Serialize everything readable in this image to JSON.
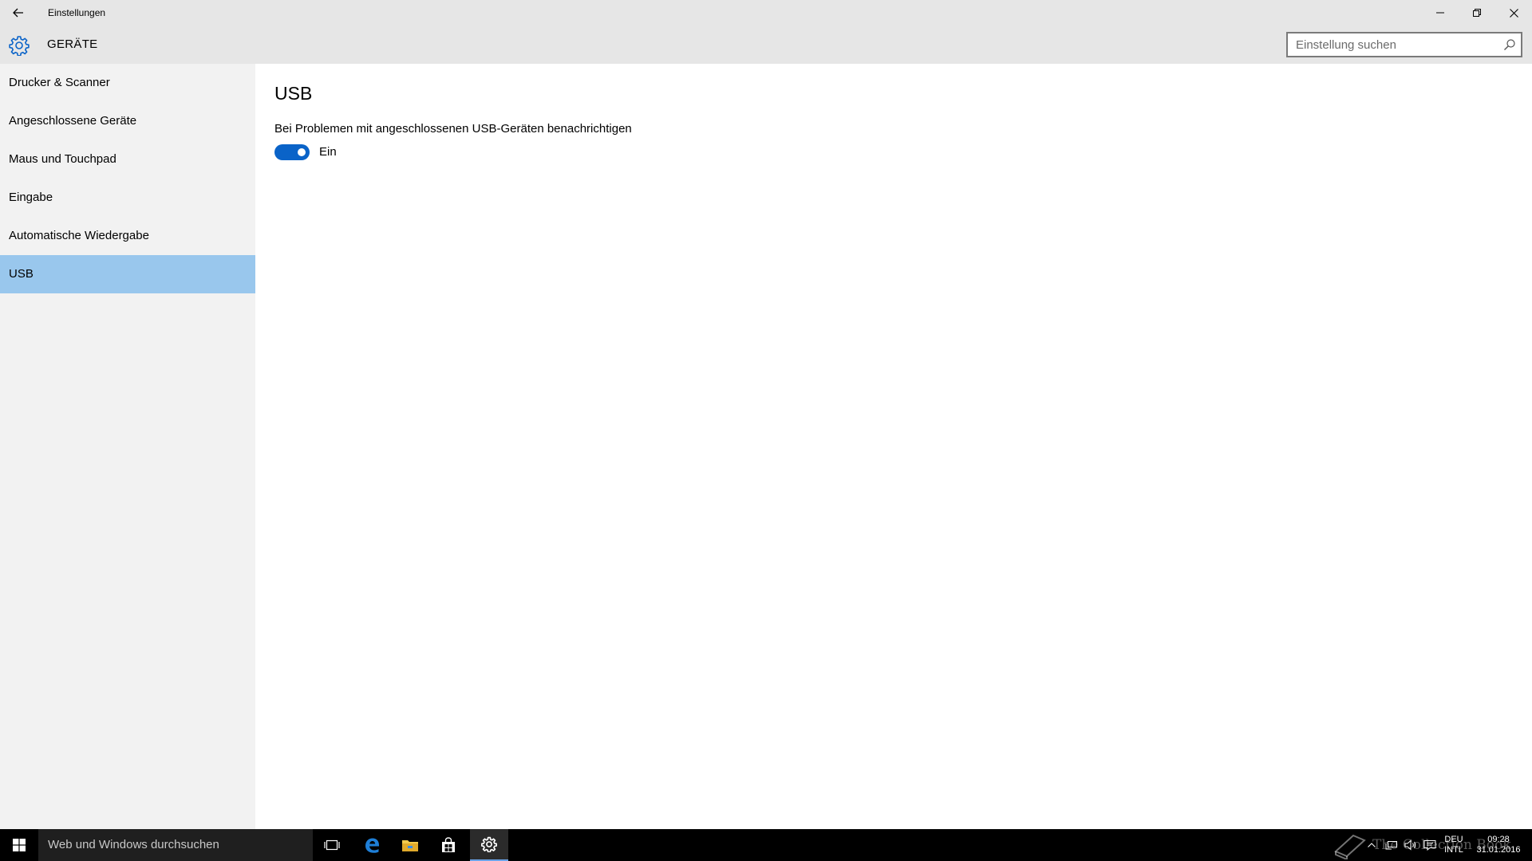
{
  "window": {
    "title": "Einstellungen"
  },
  "header": {
    "section_title": "GERÄTE",
    "search_placeholder": "Einstellung suchen"
  },
  "sidebar": {
    "items": [
      {
        "label": "Drucker & Scanner",
        "active": false
      },
      {
        "label": "Angeschlossene Geräte",
        "active": false
      },
      {
        "label": "Maus und Touchpad",
        "active": false
      },
      {
        "label": "Eingabe",
        "active": false
      },
      {
        "label": "Automatische Wiedergabe",
        "active": false
      },
      {
        "label": "USB",
        "active": true
      }
    ]
  },
  "content": {
    "page_title": "USB",
    "setting_label": "Bei Problemen mit angeschlossenen USB-Geräten benachrichtigen",
    "toggle_on": true,
    "toggle_state_label": "Ein"
  },
  "taskbar": {
    "search_placeholder": "Web und Windows durchsuchen",
    "pinned": [
      "task-view-icon",
      "edge-icon",
      "file-explorer-icon",
      "store-icon",
      "settings-icon"
    ],
    "active_app": "settings-icon",
    "language_top": "DEU",
    "language_bottom": "INTL",
    "time": "09:28",
    "date": "31.01.2016"
  },
  "watermark": {
    "text": "The Collection Book"
  },
  "colors": {
    "chrome_bg": "#e6e6e6",
    "sidebar_bg": "#f2f2f2",
    "active_item": "#99c7ed",
    "accent": "#0a63c8",
    "taskbar_bg": "#000000"
  }
}
